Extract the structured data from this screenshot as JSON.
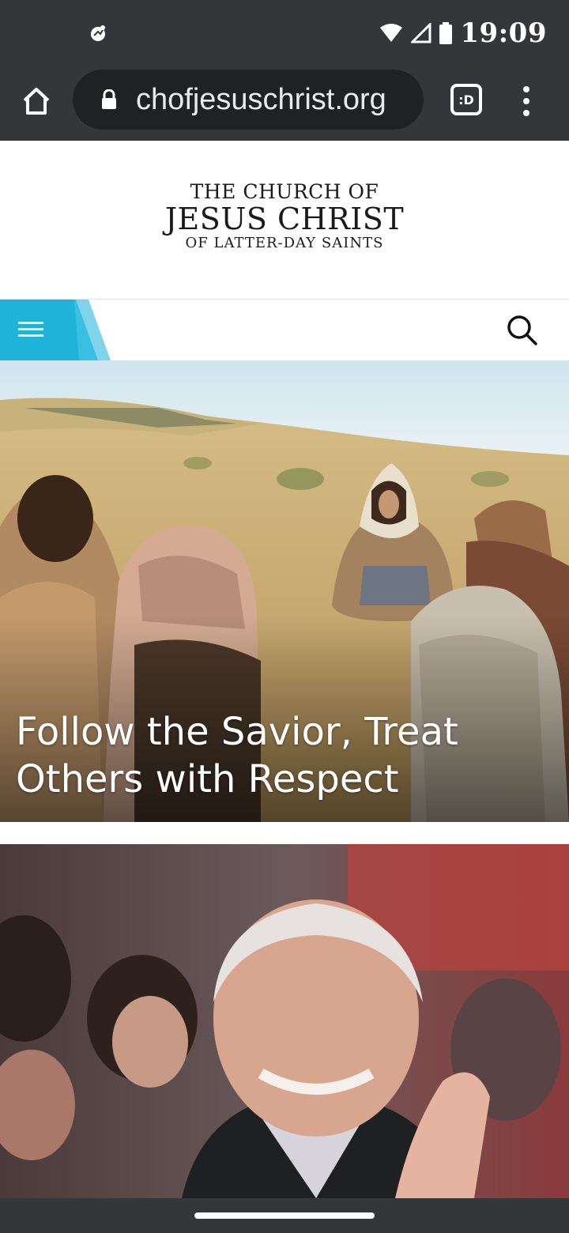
{
  "status_bar": {
    "time": "19:09",
    "left_icon": "app-notification-icon",
    "icons": [
      "wifi-icon",
      "cell-signal-icon",
      "battery-icon"
    ]
  },
  "browser": {
    "url": "chofjesuschrist.org",
    "tab_count_label": ":D",
    "icons": [
      "home-icon",
      "lock-icon",
      "tabs-icon",
      "overflow-menu-icon"
    ]
  },
  "site": {
    "logo": {
      "line1": "THE CHURCH OF",
      "line2": "JESUS CHRIST",
      "line3": "OF LATTER-DAY SAINTS"
    },
    "nav": {
      "menu_icon": "hamburger-menu-icon",
      "search_icon": "search-icon",
      "accent_color": "#1fb3d9"
    }
  },
  "hero": {
    "title": "Follow the Savior, Treat Others with Respect",
    "image": "hero-photo"
  },
  "article2": {
    "image": "article-photo"
  },
  "colors": {
    "system_bar": "#35363a",
    "omnibox": "#202124",
    "accent": "#1fb3d9"
  }
}
